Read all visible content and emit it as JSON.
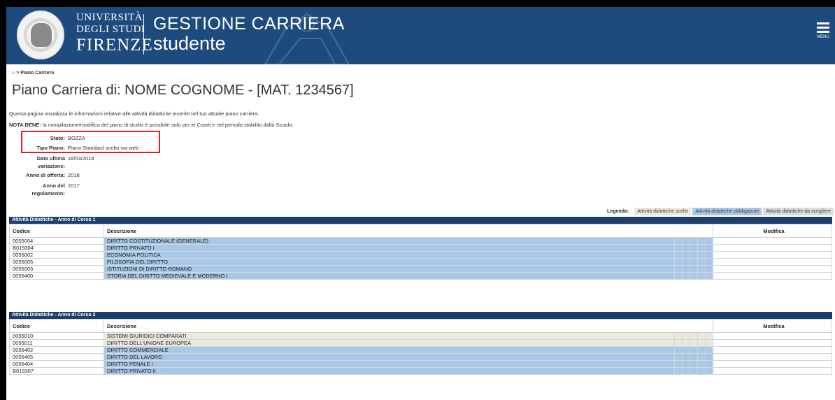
{
  "header": {
    "university_line1": "UNIVERSITÀ",
    "university_line2": "DEGLI STUDI",
    "university_line3": "FIRENZE",
    "app_title_line1": "GESTIONE CARRIERA",
    "app_title_line2": "studente",
    "menu_label": "MENU",
    "brand_color": "#1e4b7d"
  },
  "breadcrumb": {
    "home_icon": "home-icon",
    "separator": ">",
    "current": "Piano Carriera"
  },
  "page_title": "Piano Carriera di: NOME COGNOME - [MAT. 1234567]",
  "intro_text": "Questa pagina visualizza le informazioni relative alle attività didattiche inserite nel tuo attuale piano carriera.",
  "note": {
    "label": "NOTA BENE:",
    "text": "la compilazione/modifica del piano di studio è possibile solo per le Coorti e nel periodo stabilito dalla Scuola."
  },
  "details": {
    "stato_label": "Stato:",
    "stato_value": "BOZZA",
    "tipo_label": "Tipo Piano:",
    "tipo_value": "Piano Standard scelto via web",
    "data_label_1": "Data ultima",
    "data_label_2": "variazione:",
    "data_value": "18/03/2019",
    "anno_offerta_label": "Anno di offerta:",
    "anno_offerta_value": "2018",
    "anno_reg_label_1": "Anno del",
    "anno_reg_label_2": "regolamento:",
    "anno_reg_value": "2017"
  },
  "legend": {
    "label": "Legenda:",
    "scelte": "Attività didattiche scelte",
    "obbligatorie": "Attività didattiche obbligatorie",
    "da_scegliere": "Attività didattiche da scegliere"
  },
  "table1": {
    "title": "Attività Didattiche - Anno di Corso 1",
    "col_code": "Codice",
    "col_desc": "Descrizione",
    "col_mod": "Modifica",
    "rows": [
      {
        "code": "0055004",
        "desc": "DIRITTO COSTITUZIONALE (GENERALE)",
        "status": "obbligatorie"
      },
      {
        "code": "B019304",
        "desc": "DIRITTO PRIVATO I",
        "status": "obbligatorie"
      },
      {
        "code": "0055002",
        "desc": "ECONOMIA POLITICA",
        "status": "obbligatorie"
      },
      {
        "code": "0055005",
        "desc": "FILOSOFIA DEL DIRITTO",
        "status": "obbligatorie"
      },
      {
        "code": "0055003",
        "desc": "ISTITUZIONI DI DIRITTO ROMANO",
        "status": "obbligatorie"
      },
      {
        "code": "0055400",
        "desc": "STORIA DEL DIRITTO MEDIEVALE E MODERNO I",
        "status": "obbligatorie"
      }
    ]
  },
  "table2": {
    "title": "Attività Didattiche - Anno di Corso 2",
    "col_code": "Codice",
    "col_desc": "Descrizione",
    "col_mod": "Modifica",
    "rows": [
      {
        "code": "0055010",
        "desc": "SISTEMI GIURIDICI COMPARATI",
        "status": "scelte"
      },
      {
        "code": "0055011",
        "desc": "DIRITTO DELL'UNIONE EUROPEA",
        "status": "scelte"
      },
      {
        "code": "0055402",
        "desc": "DIRITTO COMMERCIALE",
        "status": "obbligatorie"
      },
      {
        "code": "0055405",
        "desc": "DIRITTO DEL LAVORO",
        "status": "obbligatorie"
      },
      {
        "code": "0055404",
        "desc": "DIRITTO PENALE I",
        "status": "obbligatorie"
      },
      {
        "code": "B019307",
        "desc": "DIRITTO PRIVATO II",
        "status": "obbligatorie"
      }
    ]
  },
  "colors": {
    "obbligatorie": "#a7c8e8",
    "scelte": "#ebe9dc",
    "da_scegliere": "#dcdcdc",
    "table_header": "#1e3f6c",
    "highlight_box": "#e02020"
  }
}
